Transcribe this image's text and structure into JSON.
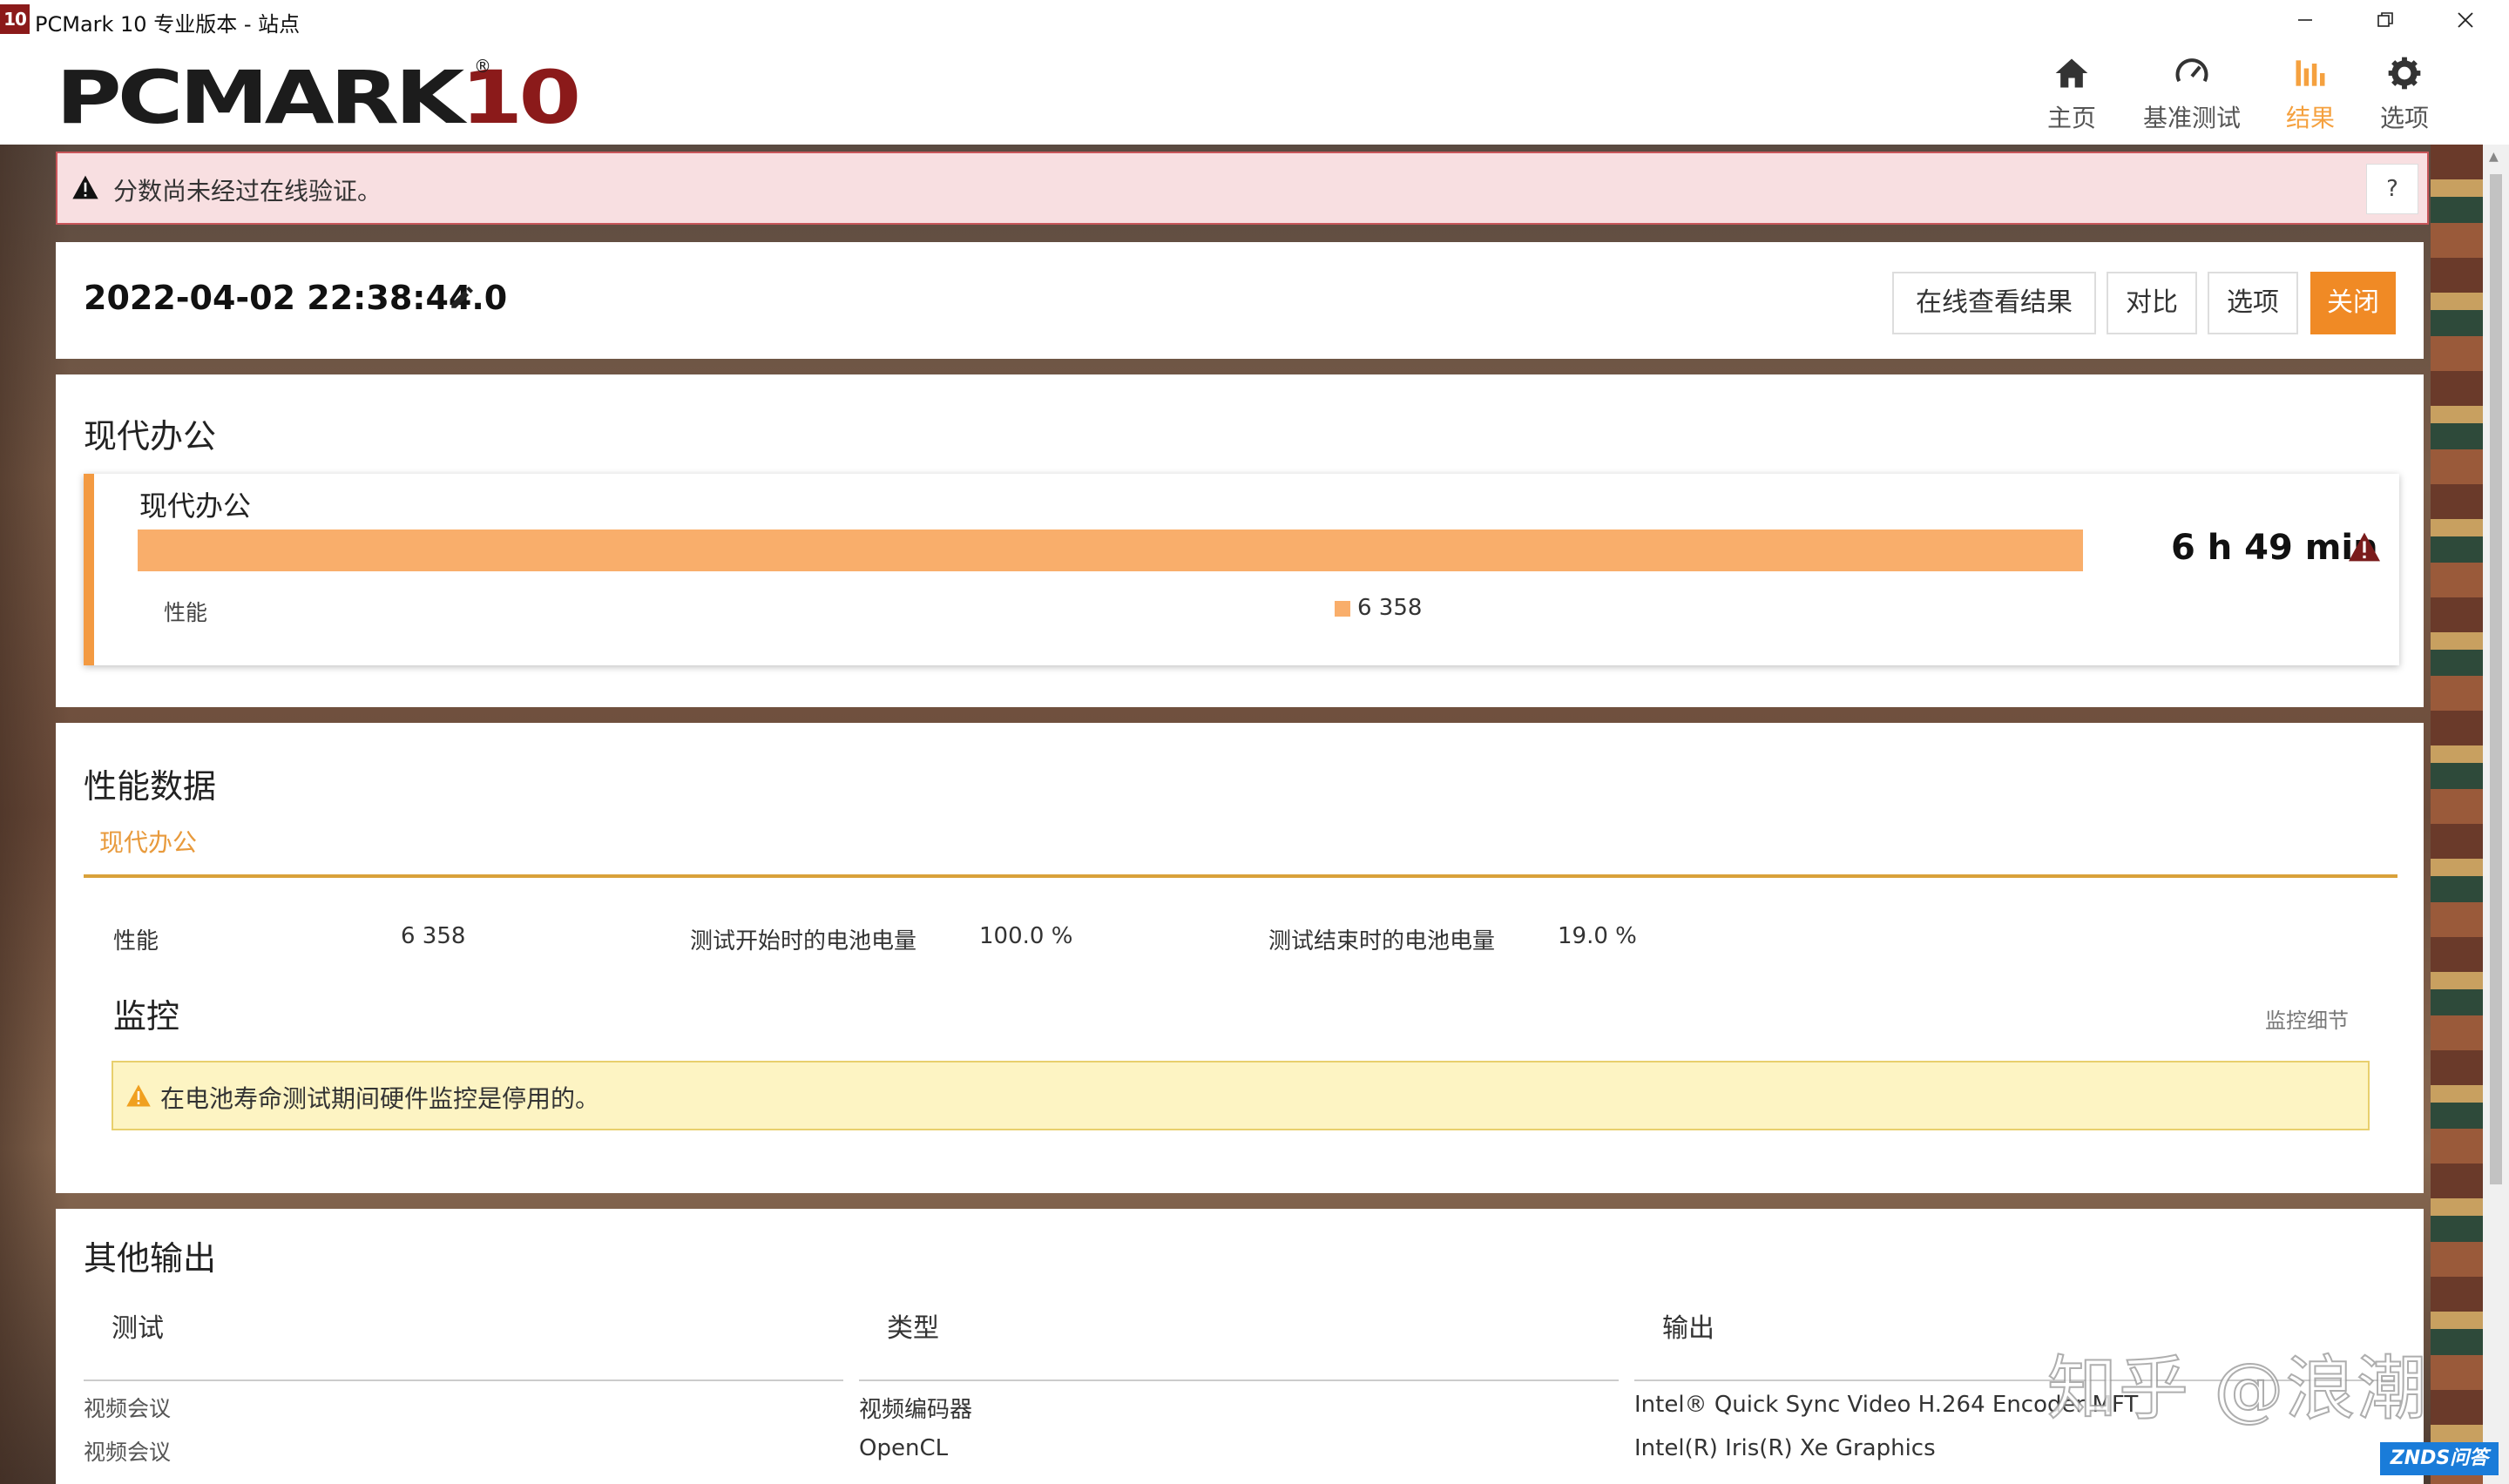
{
  "window": {
    "icon_text": "10",
    "title": "PCMark 10 专业版本 - 站点"
  },
  "header": {
    "logo_main": "PCMARK",
    "logo_num": "10",
    "logo_reg": "®",
    "nav": [
      {
        "label": "主页",
        "icon": "home-icon",
        "active": false
      },
      {
        "label": "基准测试",
        "icon": "gauge-icon",
        "active": false
      },
      {
        "label": "结果",
        "icon": "bar-chart-icon",
        "active": true
      },
      {
        "label": "选项",
        "icon": "gear-icon",
        "active": false
      }
    ],
    "accent": "#f5a13f"
  },
  "alert": {
    "text": "分数尚未经过在线验证。",
    "help": "?"
  },
  "result": {
    "date": "2022-04-02 22:38:44.0",
    "buttons": {
      "online": "在线查看结果",
      "compare": "对比",
      "options": "选项",
      "close": "关闭"
    }
  },
  "office": {
    "section_title": "现代办公",
    "card_title": "现代办公",
    "battery_life": "6 h 49 min",
    "bar_fraction": 0.99,
    "perf_label": "性能",
    "perf_score": "6 358",
    "bar_color": "#f9ae6b"
  },
  "perf": {
    "title": "性能数据",
    "tab": "现代办公",
    "items": [
      {
        "label": "性能",
        "value": "6 358"
      },
      {
        "label": "测试开始时的电池电量",
        "value": "100.0 %"
      },
      {
        "label": "测试结束时的电池电量",
        "value": "19.0 %"
      }
    ],
    "monitor_title": "监控",
    "monitor_detail": "监控细节",
    "monitor_warning": "在电池寿命测试期间硬件监控是停用的。"
  },
  "other": {
    "title": "其他输出",
    "headers": [
      "测试",
      "类型",
      "输出"
    ],
    "rows": [
      [
        "视频会议",
        "视频编码器",
        "Intel® Quick Sync Video H.264 Encoder MFT"
      ],
      [
        "视频会议",
        "OpenCL",
        "Intel(R) Iris(R) Xe Graphics"
      ]
    ]
  },
  "watermarks": {
    "zhihu": "知乎 @浪潮",
    "znds": "ZNDS问答"
  }
}
